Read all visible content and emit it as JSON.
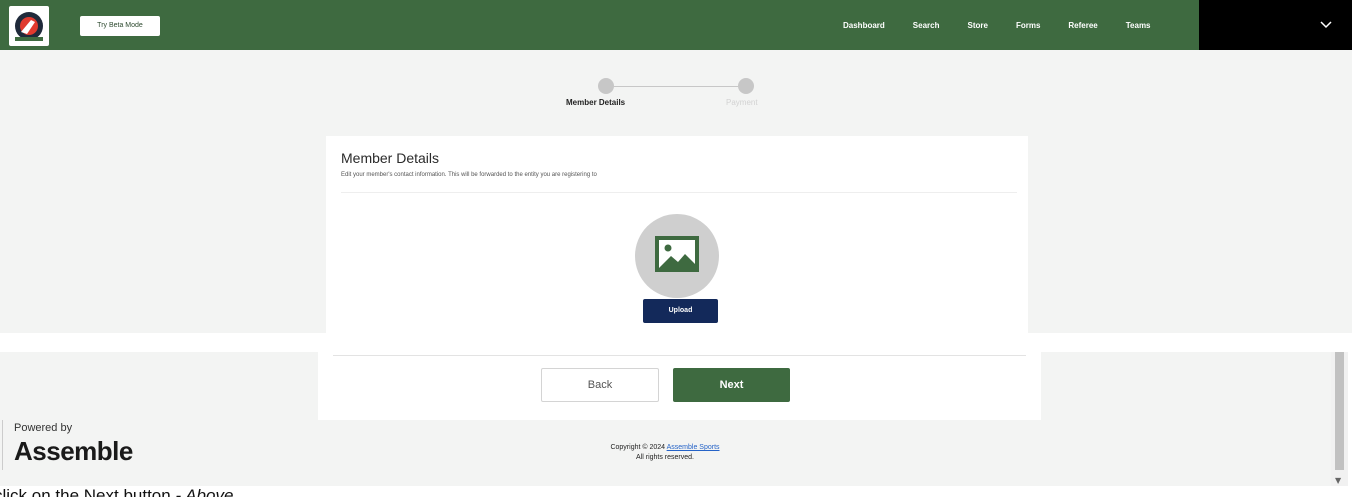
{
  "header": {
    "beta_button": "Try Beta Mode",
    "nav": [
      "Dashboard",
      "Search",
      "Store",
      "Forms",
      "Referee",
      "Teams"
    ],
    "colors": {
      "brand": "#3e6a40",
      "profile_bg": "#000000"
    }
  },
  "stepper": {
    "steps": [
      "Member Details",
      "Payment"
    ],
    "active_index": 0
  },
  "form": {
    "title": "Member Details",
    "subtitle": "Edit your member's contact information. This will be forwarded to the entity you are registering to",
    "upload_label": "Upload",
    "back_label": "Back",
    "next_label": "Next",
    "colors": {
      "upload_btn": "#13295a",
      "next_btn": "#3e6a40"
    }
  },
  "footer": {
    "powered_by": "Powered by",
    "brand": "Assemble",
    "copyright_prefix": "Copyright © 2024",
    "copyright_link": "Assemble Sports",
    "rights": "All rights reserved."
  },
  "caption": {
    "text": "click on the Next button",
    "suffix": " - Above"
  }
}
